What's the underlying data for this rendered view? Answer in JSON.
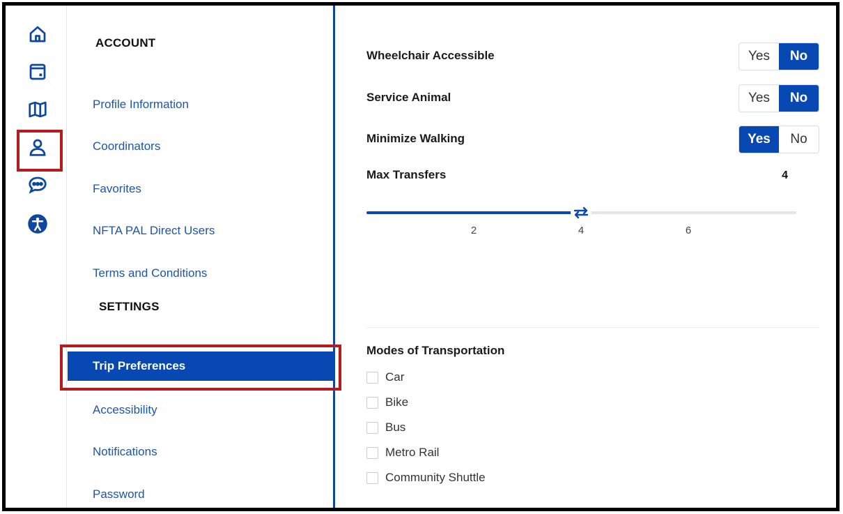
{
  "rail": {
    "icons": [
      "home-icon",
      "calendar-icon",
      "map-icon",
      "user-icon",
      "chat-icon",
      "accessibility-icon"
    ],
    "highlight_color": "#b71c1c"
  },
  "nav": {
    "account_title": "ACCOUNT",
    "account_items": [
      "Profile Information",
      "Coordinators",
      "Favorites",
      "NFTA PAL Direct Users",
      "Terms and Conditions"
    ],
    "settings_title": "SETTINGS",
    "settings_items": [
      "Trip Preferences",
      "Accessibility",
      "Notifications",
      "Password"
    ],
    "active_item": "Trip Preferences"
  },
  "preferences": {
    "wheelchair": {
      "label": "Wheelchair Accessible",
      "yes": "Yes",
      "no": "No",
      "selected": "No"
    },
    "service_animal": {
      "label": "Service Animal",
      "yes": "Yes",
      "no": "No",
      "selected": "No"
    },
    "minimize_walking": {
      "label": "Minimize Walking",
      "yes": "Yes",
      "no": "No",
      "selected": "Yes"
    },
    "max_transfers": {
      "label": "Max Transfers",
      "value": "4",
      "ticks": [
        "2",
        "4",
        "6"
      ]
    }
  },
  "modes": {
    "title": "Modes of Transportation",
    "items": [
      "Car",
      "Bike",
      "Bus",
      "Metro Rail",
      "Community Shuttle"
    ]
  },
  "colors": {
    "accent": "#0748b3",
    "link": "#1e55a6",
    "highlight": "#b71c1c"
  }
}
